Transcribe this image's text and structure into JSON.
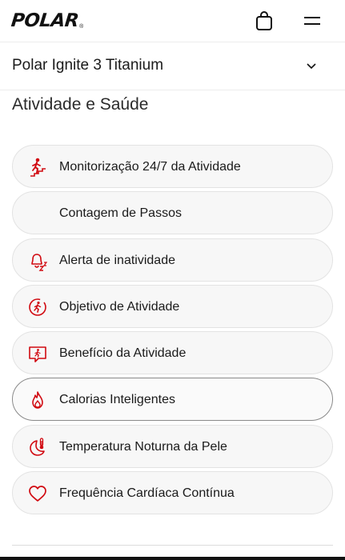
{
  "header": {
    "logo_text": "POLAR",
    "logo_reg": "®",
    "cart_icon": "shopping-bag-icon",
    "menu_icon": "hamburger-menu-icon"
  },
  "product_selector": {
    "name": "Polar Ignite 3 Titanium",
    "chevron_icon": "chevron-down-icon"
  },
  "section": {
    "title": "Atividade e Saúde"
  },
  "features": [
    {
      "label": "Monitorização 24/7 da Atividade",
      "icon": "running-stairs-icon"
    },
    {
      "label": "Contagem de Passos",
      "icon": ""
    },
    {
      "label": "Alerta de inatividade",
      "icon": "inactivity-alert-icon"
    },
    {
      "label": "Objetivo de Atividade",
      "icon": "activity-goal-icon"
    },
    {
      "label": "Benefício da Atividade",
      "icon": "activity-benefit-icon"
    },
    {
      "label": "Calorias Inteligentes",
      "icon": "flame-icon"
    },
    {
      "label": "Temperatura Noturna da Pele",
      "icon": "moon-thermometer-icon"
    },
    {
      "label": "Frequência Cardíaca Contínua",
      "icon": "heart-icon"
    }
  ],
  "colors": {
    "accent": "#d10a11",
    "text": "#1a1a1a",
    "pill_background": "#f7f7f7",
    "pill_border": "#e3e3e3"
  }
}
